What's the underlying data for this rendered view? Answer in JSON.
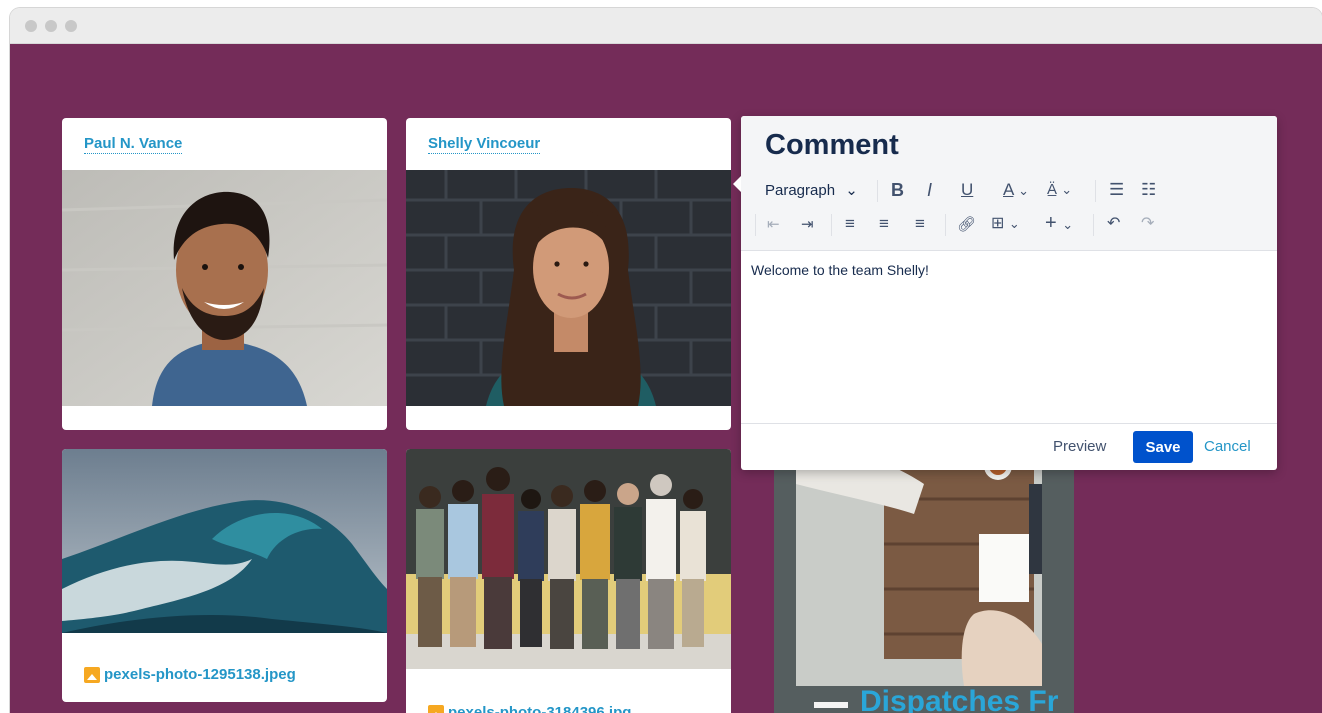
{
  "cards": {
    "paul": {
      "name": "Paul N. Vance"
    },
    "shelly": {
      "name": "Shelly Vincoeur"
    },
    "wave": {
      "file": "pexels-photo-1295138.jpeg"
    },
    "team": {
      "file": "pexels-photo-3184396.jpg"
    },
    "dispatch": {
      "title": "Dispatches Fr"
    }
  },
  "comment": {
    "title": "Comment",
    "paragraph_label": "Paragraph",
    "text": "Welcome to the team Shelly!",
    "preview_label": "Preview",
    "save_label": "Save",
    "cancel_label": "Cancel"
  },
  "colors": {
    "background": "#742c59",
    "link": "#2496c7",
    "save": "#0052cc"
  },
  "icons": {
    "bold": "B",
    "italic": "I",
    "underline": "U",
    "text_color": "A"
  }
}
